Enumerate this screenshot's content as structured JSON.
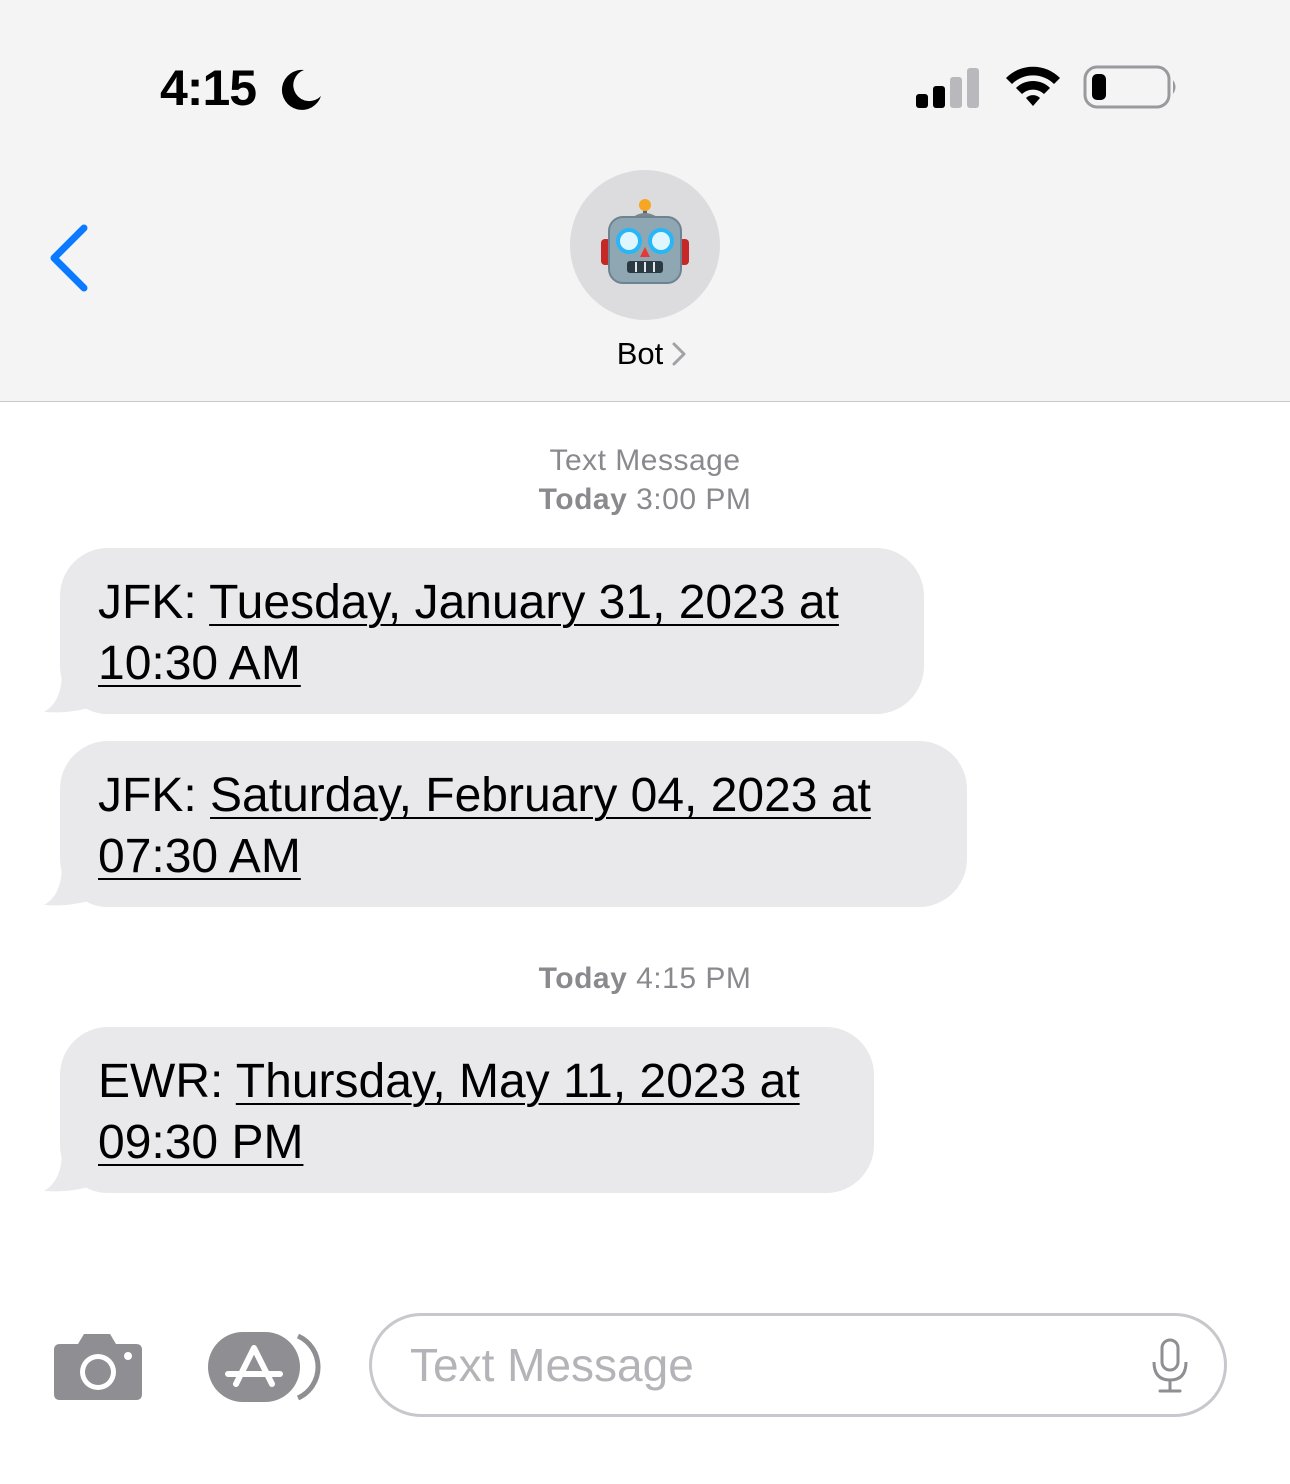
{
  "status_bar": {
    "time": "4:15",
    "focus_icon": "moon-icon",
    "signal_icon": "cellular-signal-icon",
    "wifi_icon": "wifi-icon",
    "battery_icon": "battery-icon"
  },
  "header": {
    "back_icon": "chevron-left-icon",
    "avatar_icon": "robot-emoji",
    "contact_name": "Bot",
    "contact_chevron_icon": "chevron-right-icon"
  },
  "conversation": {
    "service_label": "Text Message",
    "groups": [
      {
        "timestamp_day": "Today",
        "timestamp_time": "3:00 PM",
        "messages": [
          {
            "prefix": "JFK: ",
            "link_line1": "Tuesday, January 31, 2023 at",
            "link_line2": "10:30 AM"
          },
          {
            "prefix": "JFK: ",
            "link_line1": "Saturday, February 04, 2023 at",
            "link_line2": "07:30 AM"
          }
        ]
      },
      {
        "timestamp_day": "Today",
        "timestamp_time": "4:15 PM",
        "messages": [
          {
            "prefix": "EWR: ",
            "link_line1": "Thursday, May 11, 2023 at",
            "link_line2": "09:30 PM"
          }
        ]
      }
    ]
  },
  "input_bar": {
    "camera_icon": "camera-icon",
    "apps_icon": "app-store-icon",
    "placeholder": "Text Message",
    "mic_icon": "microphone-icon"
  },
  "colors": {
    "accent": "#0a7aff",
    "header_bg": "#f4f4f4",
    "bubble_bg": "#e9e9eb",
    "timestamp_text": "#8a8a8e",
    "icon_gray": "#8e8e93"
  }
}
